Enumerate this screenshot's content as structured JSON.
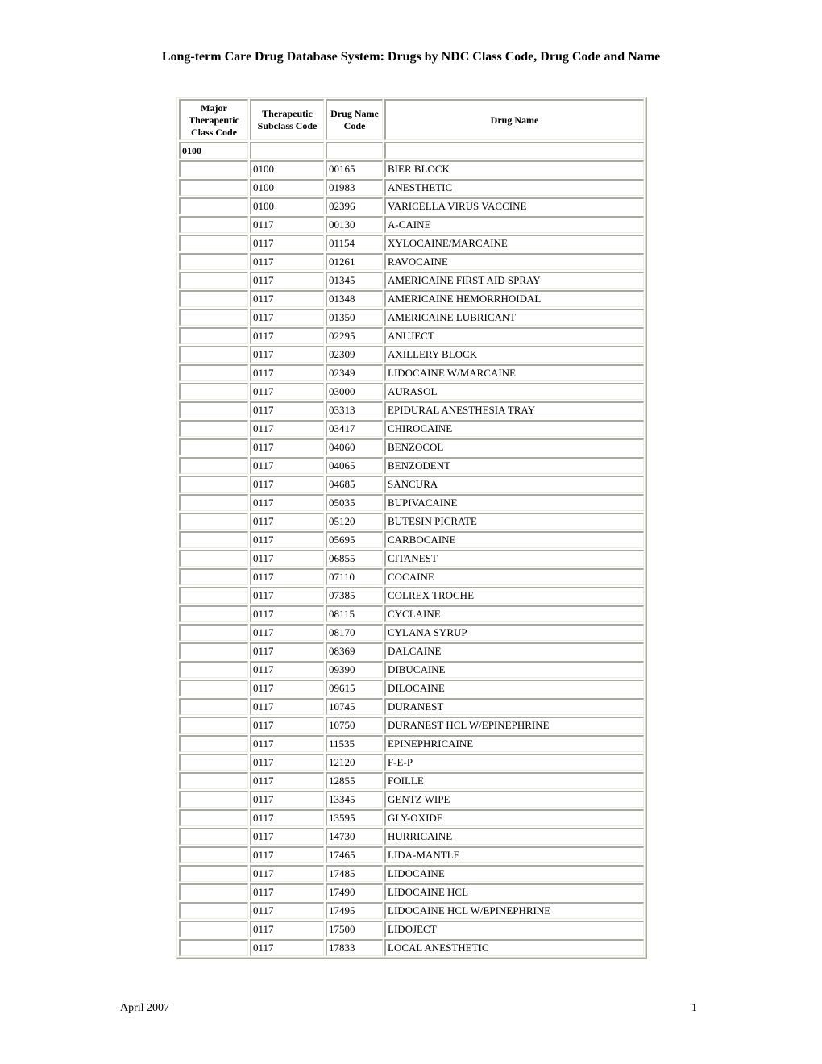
{
  "document": {
    "title": "Long-term Care Drug Database System: Drugs by NDC Class Code, Drug Code and Name"
  },
  "table": {
    "headers": {
      "major_class": "Major Therapeutic Class Code",
      "subclass": "Therapeutic Subclass Code",
      "drug_code": "Drug Name Code",
      "drug_name": "Drug Name"
    },
    "class_group": "0100",
    "rows": [
      {
        "subclass": "0100",
        "code": "00165",
        "name": "BIER BLOCK"
      },
      {
        "subclass": "0100",
        "code": "01983",
        "name": "ANESTHETIC"
      },
      {
        "subclass": "0100",
        "code": "02396",
        "name": "VARICELLA VIRUS VACCINE"
      },
      {
        "subclass": "0117",
        "code": "00130",
        "name": "A-CAINE"
      },
      {
        "subclass": "0117",
        "code": "01154",
        "name": "XYLOCAINE/MARCAINE"
      },
      {
        "subclass": "0117",
        "code": "01261",
        "name": "RAVOCAINE"
      },
      {
        "subclass": "0117",
        "code": "01345",
        "name": "AMERICAINE FIRST AID SPRAY"
      },
      {
        "subclass": "0117",
        "code": "01348",
        "name": "AMERICAINE HEMORRHOIDAL"
      },
      {
        "subclass": "0117",
        "code": "01350",
        "name": "AMERICAINE LUBRICANT"
      },
      {
        "subclass": "0117",
        "code": "02295",
        "name": "ANUJECT"
      },
      {
        "subclass": "0117",
        "code": "02309",
        "name": "AXILLERY BLOCK"
      },
      {
        "subclass": "0117",
        "code": "02349",
        "name": "LIDOCAINE W/MARCAINE"
      },
      {
        "subclass": "0117",
        "code": "03000",
        "name": "AURASOL"
      },
      {
        "subclass": "0117",
        "code": "03313",
        "name": "EPIDURAL ANESTHESIA TRAY"
      },
      {
        "subclass": "0117",
        "code": "03417",
        "name": "CHIROCAINE"
      },
      {
        "subclass": "0117",
        "code": "04060",
        "name": "BENZOCOL"
      },
      {
        "subclass": "0117",
        "code": "04065",
        "name": "BENZODENT"
      },
      {
        "subclass": "0117",
        "code": "04685",
        "name": "SANCURA"
      },
      {
        "subclass": "0117",
        "code": "05035",
        "name": "BUPIVACAINE"
      },
      {
        "subclass": "0117",
        "code": "05120",
        "name": "BUTESIN PICRATE"
      },
      {
        "subclass": "0117",
        "code": "05695",
        "name": "CARBOCAINE"
      },
      {
        "subclass": "0117",
        "code": "06855",
        "name": "CITANEST"
      },
      {
        "subclass": "0117",
        "code": "07110",
        "name": "COCAINE"
      },
      {
        "subclass": "0117",
        "code": "07385",
        "name": "COLREX TROCHE"
      },
      {
        "subclass": "0117",
        "code": "08115",
        "name": "CYCLAINE"
      },
      {
        "subclass": "0117",
        "code": "08170",
        "name": "CYLANA SYRUP"
      },
      {
        "subclass": "0117",
        "code": "08369",
        "name": "DALCAINE"
      },
      {
        "subclass": "0117",
        "code": "09390",
        "name": "DIBUCAINE"
      },
      {
        "subclass": "0117",
        "code": "09615",
        "name": "DILOCAINE"
      },
      {
        "subclass": "0117",
        "code": "10745",
        "name": "DURANEST"
      },
      {
        "subclass": "0117",
        "code": "10750",
        "name": "DURANEST HCL W/EPINEPHRINE"
      },
      {
        "subclass": "0117",
        "code": "11535",
        "name": "EPINEPHRICAINE"
      },
      {
        "subclass": "0117",
        "code": "12120",
        "name": "F-E-P"
      },
      {
        "subclass": "0117",
        "code": "12855",
        "name": "FOILLE"
      },
      {
        "subclass": "0117",
        "code": "13345",
        "name": "GENTZ WIPE"
      },
      {
        "subclass": "0117",
        "code": "13595",
        "name": "GLY-OXIDE"
      },
      {
        "subclass": "0117",
        "code": "14730",
        "name": "HURRICAINE"
      },
      {
        "subclass": "0117",
        "code": "17465",
        "name": "LIDA-MANTLE"
      },
      {
        "subclass": "0117",
        "code": "17485",
        "name": "LIDOCAINE"
      },
      {
        "subclass": "0117",
        "code": "17490",
        "name": "LIDOCAINE HCL"
      },
      {
        "subclass": "0117",
        "code": "17495",
        "name": "LIDOCAINE HCL W/EPINEPHRINE"
      },
      {
        "subclass": "0117",
        "code": "17500",
        "name": "LIDOJECT"
      },
      {
        "subclass": "0117",
        "code": "17833",
        "name": "LOCAL ANESTHETIC"
      }
    ]
  },
  "footer": {
    "date": "April 2007",
    "page_number": "1"
  }
}
